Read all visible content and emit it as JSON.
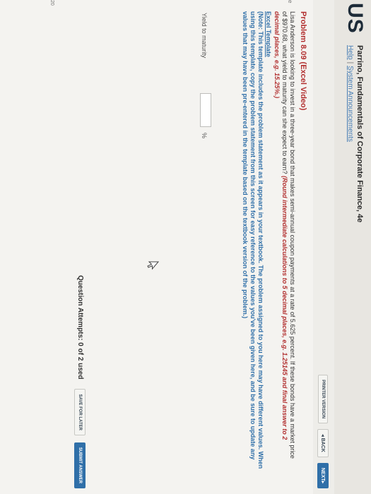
{
  "header": {
    "brand": "US",
    "book_title": "Parrino, Fundamentals of Corporate Finance, 4e",
    "help_link": "Help",
    "separator": "|",
    "announcements_link": "System Announcements"
  },
  "nav": {
    "printer_version": "PRINTER VERSION",
    "back": "◂ BACK",
    "next": "NEXT▸"
  },
  "problem": {
    "title": "Problem 8.09 (Excel Video)",
    "statement": "Lisa Anderson is looking to invest in a three-year bond that makes semi-annual coupon payments at a rate of 5.625 percent. If these bonds have a market price of $970.68, what yield to maturity can she expect to earn? ",
    "rounding_note": "(Round intermediate calculations to 5 decimal places, e.g. 1.25145 and final answer to 2 decimal places, e.g. 15.25%.)",
    "excel_heading": "Excel Template",
    "excel_note": "(Note: This template includes the problem statement as it appears in your textbook. The problem assigned to you here may have different values. When using this template, copy the problem statement from this screen for easy reference to the values you've been given here, and be sure to update any values that may have been pre-entered in the template based on the textbook version of the problem.)"
  },
  "answer": {
    "label": "Yield to maturity",
    "value": "",
    "unit": "%"
  },
  "footer": {
    "attempts": "Question Attempts: 0 of 2 used",
    "save_later": "SAVE FOR LATER",
    "submit": "SUBMIT ANSWER"
  },
  "edge": {
    "left_mark": "e",
    "page_num": "20"
  }
}
